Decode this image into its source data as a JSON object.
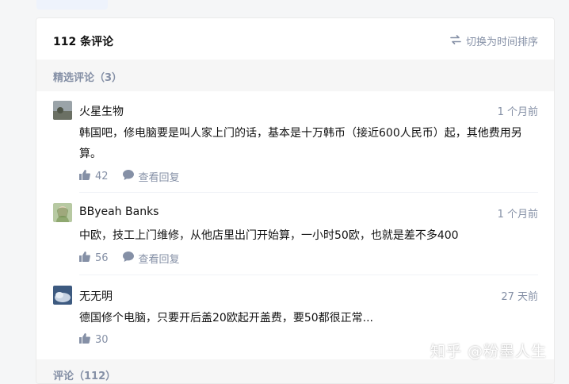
{
  "card": {
    "title": "112 条评论",
    "sort_toggle": "切换为时间排序"
  },
  "featured_section": {
    "label": "精选评论（3）"
  },
  "comments": [
    {
      "author": "火星生物",
      "time": "1 个月前",
      "content": "韩国吧，修电脑要是叫人家上门的话，基本是十万韩币（接近600人民币）起，其他费用另算。",
      "likes": "42",
      "reply_label": "查看回复"
    },
    {
      "author": "BByeah Banks",
      "time": "1 个月前",
      "content": "中欧，技工上门维修，从他店里出门开始算，一小时50欧，也就是差不多400",
      "likes": "56",
      "reply_label": "查看回复"
    },
    {
      "author": "无无明",
      "time": "27 天前",
      "content": "德国修个电脑，只要开后盖20欧起开盖费，要50都很正常...",
      "likes": "30"
    }
  ],
  "all_section": {
    "label": "评论（112）"
  },
  "watermark": "知乎 @粉墨人生",
  "colors": {
    "accent": "#0066ff",
    "muted": "#8590a6",
    "text": "#121212"
  }
}
